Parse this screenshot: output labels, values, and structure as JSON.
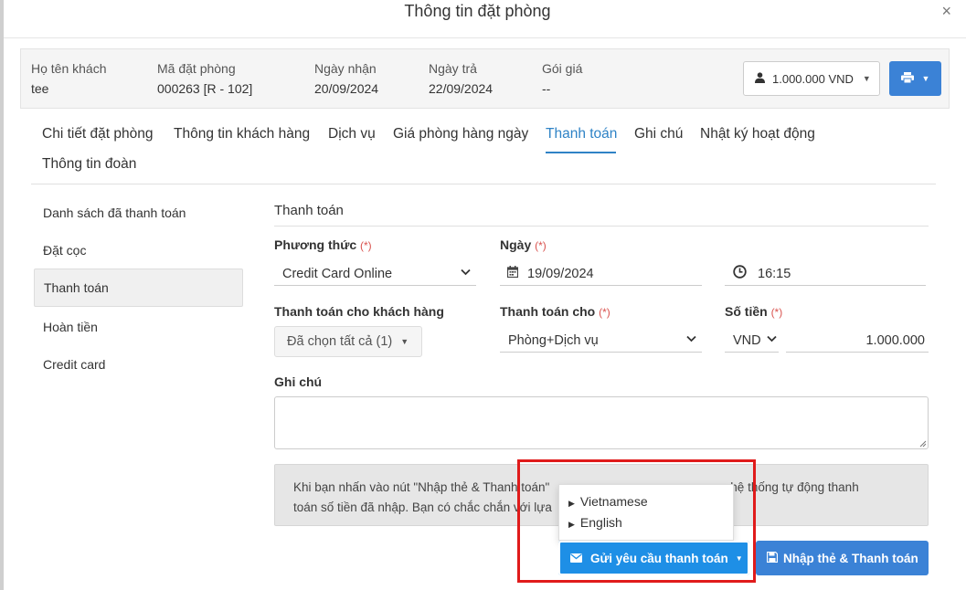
{
  "modal": {
    "title": "Thông tin đặt phòng",
    "close": "×"
  },
  "summary": {
    "guest_label": "Họ tên khách",
    "guest_value": "tee",
    "booking_label": "Mã đặt phòng",
    "booking_value": "000263 [R - 102]",
    "checkin_label": "Ngày nhận",
    "checkin_value": "20/09/2024",
    "checkout_label": "Ngày trả",
    "checkout_value": "22/09/2024",
    "rate_label": "Gói giá",
    "rate_value": "--",
    "price_button": "1.000.000 VND"
  },
  "tabs": [
    "Chi tiết đặt phòng",
    "Thông tin khách hàng",
    "Dịch vụ",
    "Giá phòng hàng ngày",
    "Thanh toán",
    "Ghi chú",
    "Nhật ký hoạt động",
    "Thông tin đoàn"
  ],
  "active_tab": "Thanh toán",
  "sidebar": {
    "items": [
      "Danh sách đã thanh toán",
      "Đặt cọc",
      "Thanh toán",
      "Hoàn tiền",
      "Credit card"
    ],
    "active": "Thanh toán"
  },
  "form": {
    "section_title": "Thanh toán",
    "method_label": "Phương thức",
    "method_value": "Credit Card Online",
    "date_label": "Ngày",
    "date_value": "19/09/2024",
    "time_value": "16:15",
    "pay_for_guest_label": "Thanh toán cho khách hàng",
    "pay_for_guest_value": "Đã chọn tất cả (1)",
    "pay_for_label": "Thanh toán cho",
    "pay_for_value": "Phòng+Dịch vụ",
    "amount_label": "Số tiền",
    "currency": "VND",
    "amount_value": "1.000.000",
    "note_label": "Ghi chú",
    "required_mark": "(*)"
  },
  "notice": {
    "line1_a": "Khi bạn nhấn vào nút \"Nhập thẻ & Thanh toán\"",
    "line1_b": "hệ thống tự động thanh",
    "line2": "toán số tiền đã nhập. Bạn có chắc chắn với lựa"
  },
  "language_menu": [
    "Vietnamese",
    "English"
  ],
  "buttons": {
    "send_request": "Gửi yêu cầu thanh toán",
    "enter_card_pay": "Nhập thẻ & Thanh toán"
  },
  "colors": {
    "primary": "#3b82d6",
    "active_tab": "#2f83c6",
    "highlight": "#e01b1b",
    "send_button": "#1e8fe6"
  }
}
